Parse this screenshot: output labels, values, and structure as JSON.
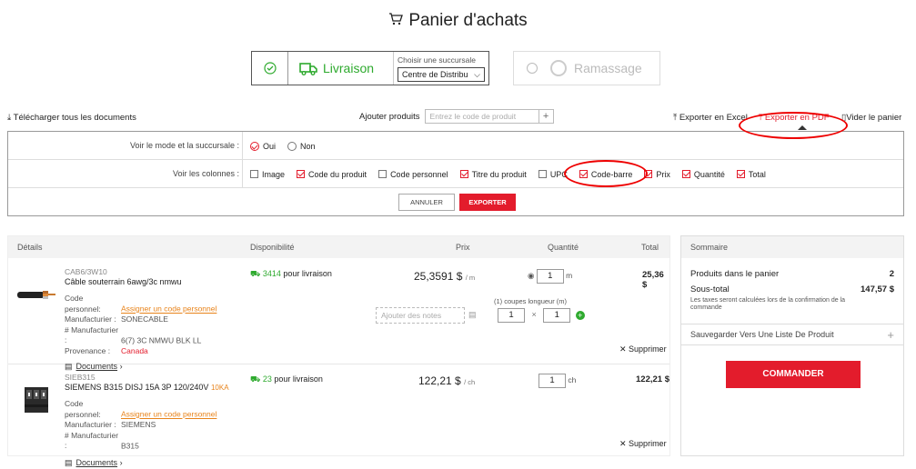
{
  "page": {
    "title": "Panier d'achats"
  },
  "delivery": {
    "livraison_label": "Livraison",
    "branch_prompt": "Choisir une succursale",
    "branch_value": "Centre de Distribu",
    "ramassage_label": "Ramassage"
  },
  "toolbar": {
    "download_all": "Télécharger tous les documents",
    "add_products_label": "Ajouter produits",
    "add_products_placeholder": "Entrez le code de produit",
    "add_plus": "+",
    "export_excel": "Exporter en Excel",
    "export_pdf": "Exporter en PDF",
    "empty_cart": "Vider le panier"
  },
  "export_panel": {
    "mode_label": "Voir le mode et la succursale :",
    "mode_yes": "Oui",
    "mode_no": "Non",
    "columns_label": "Voir les colonnes :",
    "columns": [
      {
        "label": "Image",
        "checked": false
      },
      {
        "label": "Code du produit",
        "checked": true
      },
      {
        "label": "Code personnel",
        "checked": false
      },
      {
        "label": "Titre du produit",
        "checked": true
      },
      {
        "label": "UPC",
        "checked": false
      },
      {
        "label": "Code-barre",
        "checked": true
      },
      {
        "label": "Prix",
        "checked": true
      },
      {
        "label": "Quantité",
        "checked": true
      },
      {
        "label": "Total",
        "checked": true
      }
    ],
    "cancel": "ANNULER",
    "export": "EXPORTER"
  },
  "table": {
    "headers": {
      "details": "Détails",
      "availability": "Disponibilité",
      "price": "Prix",
      "quantity": "Quantité",
      "total": "Total"
    },
    "items": [
      {
        "sku": "CAB6/3W10",
        "name": "Câble souterrain 6awg/3c nmwu",
        "personal_code_key": "Code personnel:",
        "personal_code_link": "Assigner un code personnel",
        "manufacturer_key": "Manufacturier :",
        "manufacturer": "SONECABLE",
        "mfr_num_key": "# Manufacturier :",
        "mfr_num": "6(7) 3C NMWU BLK LL",
        "origin_key": "Provenance :",
        "origin": "Canada",
        "documents": "Documents",
        "stock": "3414",
        "stock_text": "pour livraison",
        "price": "25,3591 $",
        "unit": "/ m",
        "qty": "1",
        "qty_unit": "m",
        "notes_placeholder": "Ajouter des notes",
        "coupes_label": "(1) coupes longueur (m)",
        "coupes": "1",
        "length": "1",
        "times": "×",
        "total": "25,36 $",
        "delete": "Supprimer"
      },
      {
        "sku": "SIEB315",
        "name": "SIEMENS B315 DISJ 15A 3P 120/240V",
        "name_suffix": "10KA",
        "personal_code_key": "Code personnel:",
        "personal_code_link": "Assigner un code personnel",
        "manufacturer_key": "Manufacturier :",
        "manufacturer": "SIEMENS",
        "mfr_num_key": "# Manufacturier :",
        "mfr_num": "B315",
        "documents": "Documents",
        "stock": "23",
        "stock_text": "pour livraison",
        "price": "122,21 $",
        "unit": "/ ch",
        "qty": "1",
        "qty_unit": "ch",
        "total": "122,21 $",
        "delete": "Supprimer"
      }
    ]
  },
  "summary": {
    "title": "Sommaire",
    "products_label": "Produits dans le panier",
    "products_count": "2",
    "subtotal_label": "Sous-total",
    "subtotal": "147,57 $",
    "tax_note": "Les taxes seront calculées lors de la confirmation de la commande",
    "save_list": "Sauvegarder Vers Une Liste De Produit",
    "save_plus": "+",
    "order": "COMMANDER"
  },
  "colors": {
    "accent": "#e31c2c",
    "green": "#2eaa2e",
    "link": "#e8831a"
  }
}
